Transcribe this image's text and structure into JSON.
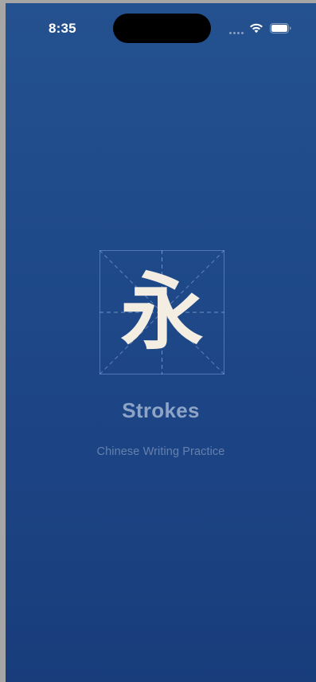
{
  "status_bar": {
    "time": "8:35",
    "icons": [
      "cellular-signal-icon",
      "wifi-icon",
      "battery-icon"
    ]
  },
  "splash": {
    "character": "永",
    "title": "Strokes",
    "subtitle": "Chinese Writing Practice"
  },
  "colors": {
    "background_top": "#24518f",
    "background_bottom": "#193d7b",
    "character": "#f4eee2",
    "title": "#8ea4c6",
    "subtitle": "#6480ad",
    "grid_lines": "#6a8bbf"
  }
}
